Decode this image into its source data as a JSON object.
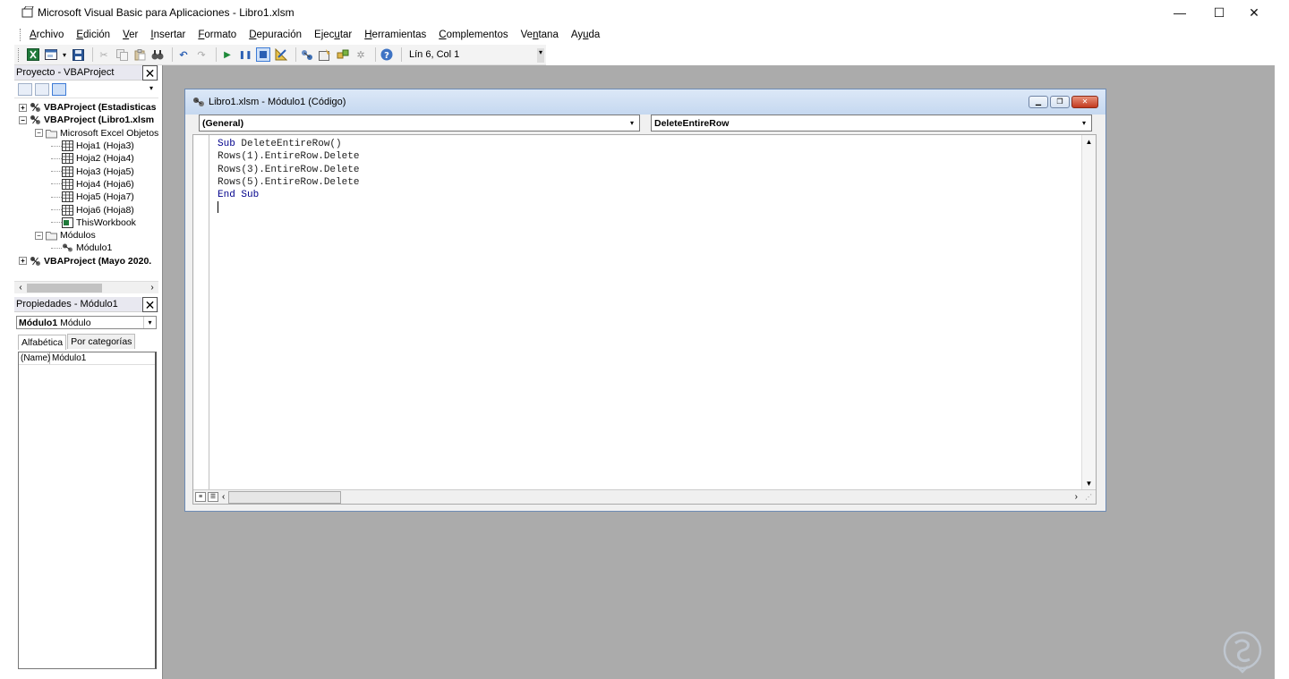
{
  "window": {
    "title": "Microsoft Visual Basic para Aplicaciones - Libro1.xlsm",
    "minimize_glyph": "—",
    "maximize_glyph": "☐",
    "close_glyph": "✕"
  },
  "menu": [
    {
      "pre": "",
      "u": "A",
      "post": "rchivo"
    },
    {
      "pre": "",
      "u": "E",
      "post": "dición"
    },
    {
      "pre": "",
      "u": "V",
      "post": "er"
    },
    {
      "pre": "",
      "u": "I",
      "post": "nsertar"
    },
    {
      "pre": "",
      "u": "F",
      "post": "ormato"
    },
    {
      "pre": "",
      "u": "D",
      "post": "epuración"
    },
    {
      "pre": "Ejec",
      "u": "u",
      "post": "tar"
    },
    {
      "pre": "",
      "u": "H",
      "post": "erramientas"
    },
    {
      "pre": "",
      "u": "C",
      "post": "omplementos"
    },
    {
      "pre": "Ve",
      "u": "n",
      "post": "tana"
    },
    {
      "pre": "Ay",
      "u": "u",
      "post": "da"
    }
  ],
  "toolbar": {
    "icons": [
      "excel-icon",
      "insert-userform-icon",
      "save-icon",
      "cut-icon",
      "copy-icon",
      "paste-icon",
      "find-icon",
      "undo-icon",
      "redo-icon",
      "run-icon",
      "break-icon",
      "reset-icon",
      "design-mode-icon",
      "project-explorer-icon",
      "properties-icon",
      "object-browser-icon",
      "toolbox-icon",
      "help-icon"
    ],
    "position": "Lín 6, Col 1"
  },
  "project_pane": {
    "title": "Proyecto - VBAProject",
    "tree": [
      {
        "label": "VBAProject (Estadisticas",
        "bold": true,
        "level": 0,
        "exp": "+",
        "icon": "vbaproject-icon"
      },
      {
        "label": "VBAProject (Libro1.xlsm",
        "bold": true,
        "level": 0,
        "exp": "−",
        "icon": "vbaproject-icon"
      },
      {
        "label": "Microsoft Excel Objetos",
        "bold": false,
        "level": 1,
        "exp": "−",
        "icon": "folder-icon"
      },
      {
        "label": "Hoja1 (Hoja3)",
        "bold": false,
        "level": 2,
        "exp": "",
        "icon": "worksheet-icon"
      },
      {
        "label": "Hoja2 (Hoja4)",
        "bold": false,
        "level": 2,
        "exp": "",
        "icon": "worksheet-icon"
      },
      {
        "label": "Hoja3 (Hoja5)",
        "bold": false,
        "level": 2,
        "exp": "",
        "icon": "worksheet-icon"
      },
      {
        "label": "Hoja4 (Hoja6)",
        "bold": false,
        "level": 2,
        "exp": "",
        "icon": "worksheet-icon"
      },
      {
        "label": "Hoja5 (Hoja7)",
        "bold": false,
        "level": 2,
        "exp": "",
        "icon": "worksheet-icon"
      },
      {
        "label": "Hoja6 (Hoja8)",
        "bold": false,
        "level": 2,
        "exp": "",
        "icon": "worksheet-icon"
      },
      {
        "label": "ThisWorkbook",
        "bold": false,
        "level": 2,
        "exp": "",
        "icon": "workbook-icon"
      },
      {
        "label": "Módulos",
        "bold": false,
        "level": 1,
        "exp": "−",
        "icon": "folder-icon"
      },
      {
        "label": "Módulo1",
        "bold": false,
        "level": 2,
        "exp": "",
        "icon": "module-icon"
      },
      {
        "label": "VBAProject (Mayo 2020.",
        "bold": true,
        "level": 0,
        "exp": "+",
        "icon": "vbaproject-icon"
      }
    ]
  },
  "properties_pane": {
    "title": "Propiedades - Módulo1",
    "object_name": "Módulo1",
    "object_type": "Módulo",
    "tabs": [
      "Alfabética",
      "Por categorías"
    ],
    "rows": [
      {
        "key": "(Name)",
        "value": "Módulo1"
      }
    ]
  },
  "code_window": {
    "title": "Libro1.xlsm - Módulo1 (Código)",
    "object_combo": "(General)",
    "procedure_combo": "DeleteEntireRow",
    "lines": [
      [
        {
          "t": "Sub ",
          "kw": true
        },
        {
          "t": "DeleteEntireRow()",
          "kw": false
        }
      ],
      [
        {
          "t": "Rows(1).EntireRow.Delete",
          "kw": false
        }
      ],
      [
        {
          "t": "Rows(3).EntireRow.Delete",
          "kw": false
        }
      ],
      [
        {
          "t": "Rows(5).EntireRow.Delete",
          "kw": false
        }
      ],
      [
        {
          "t": "End Sub",
          "kw": true
        }
      ]
    ]
  },
  "colors": {
    "mdi_background": "#ababab",
    "keyword": "#00008b",
    "close_button": "#c2391f"
  }
}
